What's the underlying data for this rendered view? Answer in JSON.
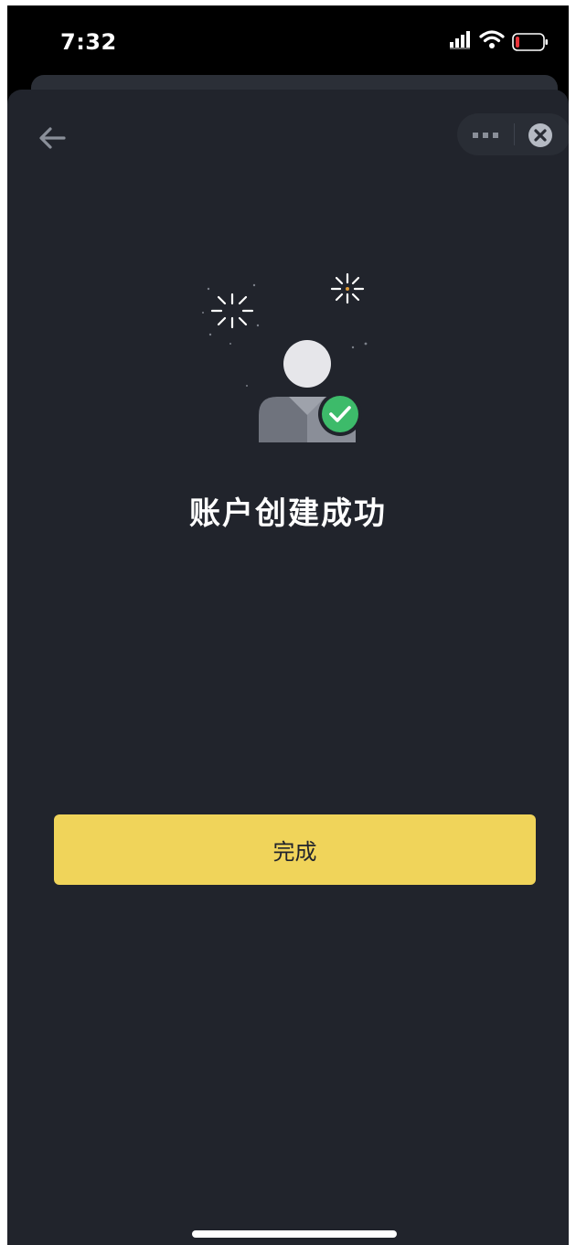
{
  "status_bar": {
    "time": "7:32",
    "icons": [
      "signal-icon",
      "wifi-icon",
      "battery-icon"
    ],
    "battery_level_fraction": 0.15
  },
  "nav": {
    "back_icon": "arrow-left-icon",
    "more_icon": "more-icon",
    "close_icon": "close-icon"
  },
  "content": {
    "illustration_icon": "user-verified-icon",
    "title": "账户创建成功"
  },
  "actions": {
    "done_label": "完成"
  },
  "colors": {
    "sheet_background": "#21242c",
    "accent_button": "#f0d45a",
    "success_green": "#3dbb6a",
    "battery_low": "#e8343a"
  }
}
